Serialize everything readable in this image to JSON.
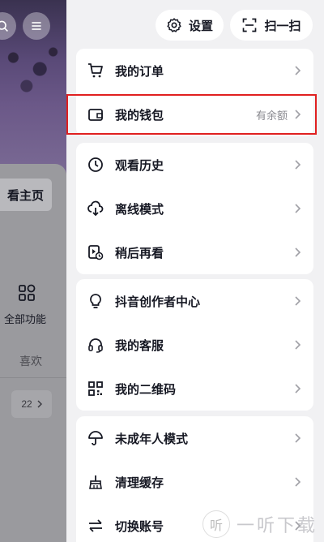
{
  "background_page": {
    "home_button_label": "看主页",
    "all_functions_label": "全部功能",
    "likes_tab_label": "喜欢",
    "count_label": "22"
  },
  "top_bar": {
    "settings_label": "设置",
    "scan_label": "扫一扫"
  },
  "menu": {
    "orders": {
      "label": "我的订单"
    },
    "wallet": {
      "label": "我的钱包",
      "extra": "有余额"
    },
    "history": {
      "label": "观看历史"
    },
    "offline": {
      "label": "离线模式"
    },
    "watch_later": {
      "label": "稍后再看"
    },
    "creator_center": {
      "label": "抖音创作者中心"
    },
    "customer_service": {
      "label": "我的客服"
    },
    "qr_code": {
      "label": "我的二维码"
    },
    "teen_mode": {
      "label": "未成年人模式"
    },
    "clear_cache": {
      "label": "清理缓存"
    },
    "switch_account": {
      "label": "切换账号"
    }
  },
  "watermark": {
    "logo_text": "听",
    "text": "一听下载"
  },
  "colors": {
    "highlight": "#e02020",
    "background": "#f1f1f3",
    "card": "#ffffff",
    "text": "#161823"
  }
}
